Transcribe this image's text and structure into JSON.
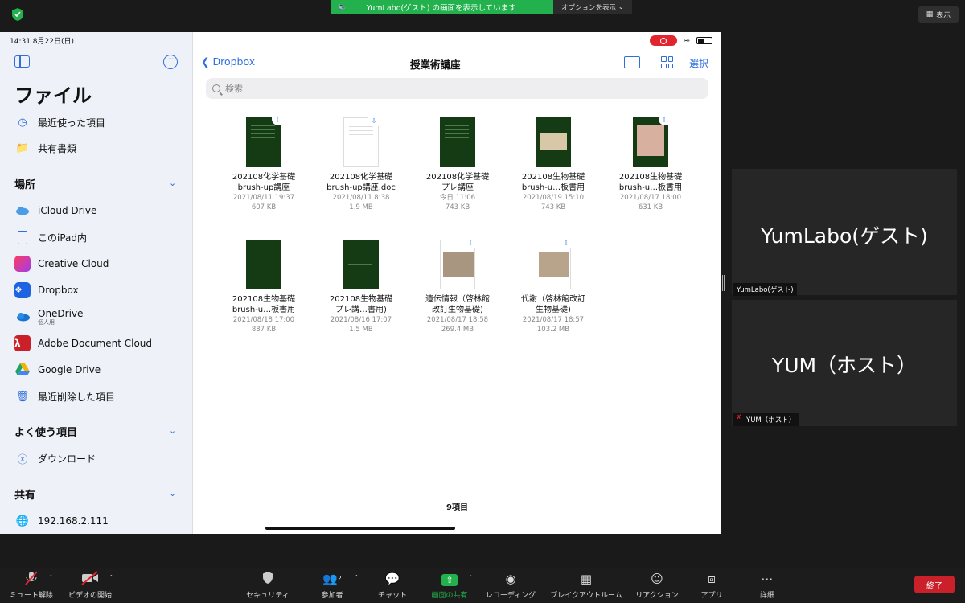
{
  "banner": {
    "text": "YumLabo(ゲスト) の画面を表示しています",
    "options_label": "オプションを表示"
  },
  "view_label": "表示",
  "ipad": {
    "time": "14:31  8月22日(日)",
    "sidebar": {
      "title": "ファイル",
      "recent": "最近使った項目",
      "shared_docs": "共有書類",
      "section_locations": "場所",
      "locations": [
        {
          "label": "iCloud Drive",
          "icon": "cloud-icon"
        },
        {
          "label": "このiPad内",
          "icon": "ipad-icon"
        },
        {
          "label": "Creative Cloud",
          "icon": "creative-cloud-icon"
        },
        {
          "label": "Dropbox",
          "icon": "dropbox-icon"
        },
        {
          "label": "OneDrive",
          "sub": "個人用",
          "icon": "onedrive-icon"
        },
        {
          "label": "Adobe Document Cloud",
          "icon": "adobe-icon"
        },
        {
          "label": "Google Drive",
          "icon": "google-drive-icon"
        },
        {
          "label": "最近削除した項目",
          "icon": "trash-icon"
        }
      ],
      "section_favorites": "よく使う項目",
      "downloads": "ダウンロード",
      "section_shared": "共有",
      "server": "192.168.2.111"
    },
    "nav": {
      "back": "Dropbox",
      "title": "授業術講座",
      "select": "選択"
    },
    "search_placeholder": "検索",
    "files": [
      {
        "name1": "202108化学基礎",
        "name2": "brush-up講座",
        "date": "2021/08/11 19:37",
        "size": "607 KB"
      },
      {
        "name1": "202108化学基礎",
        "name2": "brush-up講座.doc",
        "date": "2021/08/11 8:38",
        "size": "1.9 MB"
      },
      {
        "name1": "202108化学基礎",
        "name2": "プレ講座",
        "date": "今日 11:06",
        "size": "743 KB"
      },
      {
        "name1": "202108生物基礎",
        "name2": "brush-u…板書用",
        "date": "2021/08/19 15:10",
        "size": "743 KB"
      },
      {
        "name1": "202108生物基礎",
        "name2": "brush-u…板書用",
        "date": "2021/08/17 18:00",
        "size": "631 KB"
      },
      {
        "name1": "202108生物基礎",
        "name2": "brush-u…板書用",
        "date": "2021/08/18 17:00",
        "size": "887 KB"
      },
      {
        "name1": "202108生物基礎",
        "name2": "プレ講…書用)",
        "date": "2021/08/16 17:07",
        "size": "1.5 MB"
      },
      {
        "name1": "遺伝情報（啓林館",
        "name2": "改訂生物基礎)",
        "date": "2021/08/17 18:58",
        "size": "269.4 MB"
      },
      {
        "name1": "代謝（啓林館改訂",
        "name2": "生物基礎)",
        "date": "2021/08/17 18:57",
        "size": "103.2 MB"
      }
    ],
    "item_count": "9項目"
  },
  "participants": [
    {
      "display": "YumLabo(ゲスト)",
      "tag": "YumLabo(ゲスト)"
    },
    {
      "display": "YUM（ホスト）",
      "tag": "YUM（ホスト）"
    }
  ],
  "toolbar": {
    "mute": "ミュート解除",
    "video": "ビデオの開始",
    "security": "セキュリティ",
    "participants": "参加者",
    "participants_count": "2",
    "chat": "チャット",
    "share": "画面の共有",
    "record": "レコーディング",
    "breakout": "ブレイクアウトルーム",
    "reaction": "リアクション",
    "apps": "アプリ",
    "more": "詳細",
    "end": "終了"
  }
}
